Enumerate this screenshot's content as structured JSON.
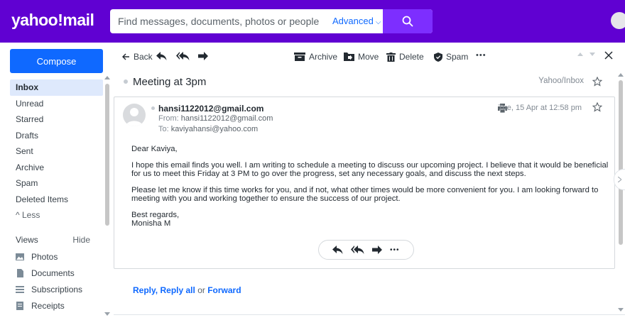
{
  "app": {
    "logo": "yahoo!mail"
  },
  "search": {
    "placeholder": "Find messages, documents, photos or people",
    "advanced_label": "Advanced"
  },
  "sidebar": {
    "compose_label": "Compose",
    "items": [
      {
        "label": "Inbox",
        "active": true
      },
      {
        "label": "Unread"
      },
      {
        "label": "Starred"
      },
      {
        "label": "Drafts"
      },
      {
        "label": "Sent"
      },
      {
        "label": "Archive"
      },
      {
        "label": "Spam"
      },
      {
        "label": "Deleted Items"
      },
      {
        "label": "^ Less"
      }
    ],
    "views_label": "Views",
    "hide_label": "Hide",
    "views": [
      {
        "label": "Photos",
        "icon": "photos-icon"
      },
      {
        "label": "Documents",
        "icon": "documents-icon"
      },
      {
        "label": "Subscriptions",
        "icon": "subscriptions-icon"
      },
      {
        "label": "Receipts",
        "icon": "receipts-icon"
      }
    ]
  },
  "toolbar": {
    "back_label": "Back",
    "archive_label": "Archive",
    "move_label": "Move",
    "delete_label": "Delete",
    "spam_label": "Spam",
    "more_label": "•••"
  },
  "message": {
    "subject": "Meeting at 3pm",
    "folder": "Yahoo/Inbox",
    "sender": "hansi1122012@gmail.com",
    "from_label": "From:",
    "from": "hansi1122012@gmail.com",
    "to_label": "To:",
    "to": "kaviyahansi@yahoo.com",
    "date": "Tue, 15 Apr at 12:58 pm",
    "body": {
      "greeting": "Dear Kaviya,",
      "para1": "I hope this email finds you well. I am writing to schedule a meeting to discuss our upcoming project. I believe that it would be beneficial for us to meet this Friday at 3 PM to go over the progress, set any necessary goals, and discuss the next steps.",
      "para2": "Please let me know if this time works for you, and if not, what other times would be more convenient for you. I am looking forward to meeting with you and working together to ensure the success of our project.",
      "closing": "Best regards,",
      "signature": "Monisha M"
    }
  },
  "reply_row": {
    "reply": "Reply",
    "comma": ",",
    "reply_all": "Reply all",
    "or": "or",
    "forward": "Forward"
  },
  "colors": {
    "brand": "#6001d2",
    "accent": "#0f69ff",
    "search_button": "#7d2eff",
    "active_nav": "#dee9fc"
  }
}
